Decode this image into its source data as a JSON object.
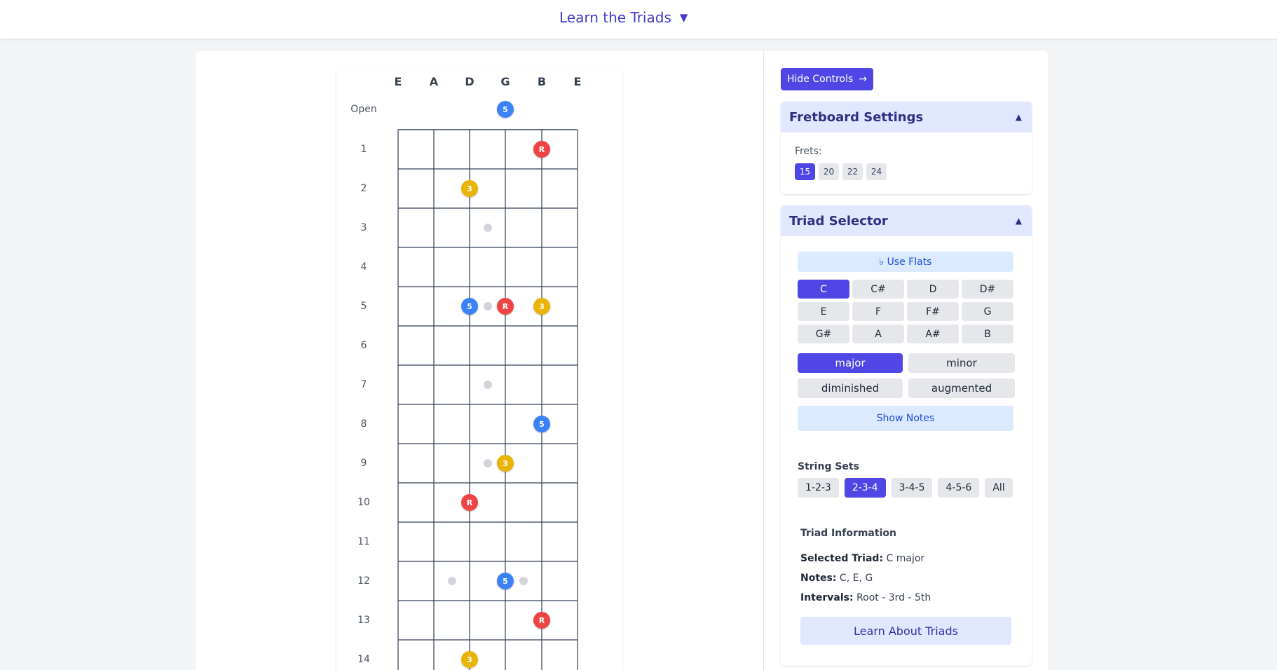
{
  "header": {
    "title": "Learn the Triads",
    "caret": "▼"
  },
  "fretboard": {
    "strings": [
      "E",
      "A",
      "D",
      "G",
      "B",
      "E"
    ],
    "open_label": "Open",
    "fret_numbers": [
      "1",
      "2",
      "3",
      "4",
      "5",
      "6",
      "7",
      "8",
      "9",
      "10",
      "11",
      "12",
      "13",
      "14"
    ],
    "open_notes": [
      {
        "string": 3,
        "label": "5",
        "role": "fifth"
      }
    ],
    "notes": [
      {
        "fret": 1,
        "string": 4,
        "label": "R",
        "role": "root"
      },
      {
        "fret": 2,
        "string": 2,
        "label": "3",
        "role": "third"
      },
      {
        "fret": 5,
        "string": 2,
        "label": "5",
        "role": "fifth"
      },
      {
        "fret": 5,
        "string": 3,
        "label": "R",
        "role": "root"
      },
      {
        "fret": 5,
        "string": 4,
        "label": "3",
        "role": "third"
      },
      {
        "fret": 8,
        "string": 4,
        "label": "5",
        "role": "fifth"
      },
      {
        "fret": 9,
        "string": 3,
        "label": "3",
        "role": "third"
      },
      {
        "fret": 10,
        "string": 2,
        "label": "R",
        "role": "root"
      },
      {
        "fret": 12,
        "string": 3,
        "label": "5",
        "role": "fifth"
      },
      {
        "fret": 13,
        "string": 4,
        "label": "R",
        "role": "root"
      },
      {
        "fret": 14,
        "string": 2,
        "label": "3",
        "role": "third"
      }
    ],
    "single_inlay_frets": [
      3,
      5,
      7,
      9
    ],
    "double_inlay_frets": [
      12
    ],
    "colors": {
      "root": "#ef4444",
      "third": "#eab308",
      "fifth": "#3b82f6",
      "grid": "#334155",
      "inlay": "#d1d5db"
    }
  },
  "controls": {
    "hide_label": "Hide Controls",
    "hide_arrow": "→",
    "fretboard_settings": {
      "heading": "Fretboard Settings",
      "toggle": "▲",
      "frets_label": "Frets:",
      "fret_options": [
        "15",
        "20",
        "22",
        "24"
      ],
      "selected": "15"
    },
    "triad_selector": {
      "heading": "Triad Selector",
      "toggle": "▲",
      "flats_button": "♭ Use Flats",
      "keys": [
        "C",
        "C#",
        "D",
        "D#",
        "E",
        "F",
        "F#",
        "G",
        "G#",
        "A",
        "A#",
        "B"
      ],
      "selected_key": "C",
      "qualities": [
        "major",
        "minor",
        "diminished",
        "augmented"
      ],
      "selected_quality": "major",
      "show_notes": "Show Notes",
      "string_sets_label": "String Sets",
      "string_sets": [
        "1-2-3",
        "2-3-4",
        "3-4-5",
        "4-5-6",
        "All"
      ],
      "selected_string_set": "2-3-4",
      "info": {
        "title": "Triad Information",
        "selected_label": "Selected Triad:",
        "selected_value": "C major",
        "notes_label": "Notes:",
        "notes_value": "C, E, G",
        "intervals_label": "Intervals:",
        "intervals_value": "Root - 3rd - 5th"
      },
      "learn_button": "Learn About Triads"
    }
  },
  "accent_color": "#4f46e5"
}
